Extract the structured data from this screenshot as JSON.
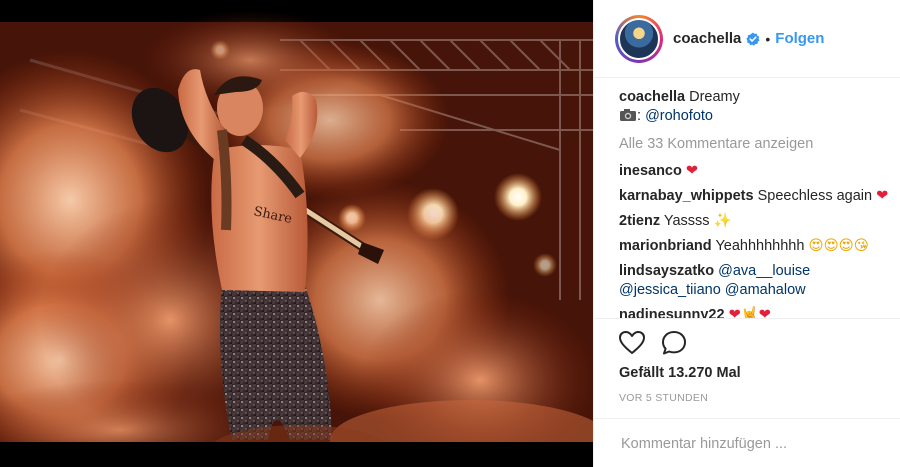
{
  "post": {
    "username": "coachella",
    "verified_icon": "verified-badge-icon",
    "separator": "•",
    "follow_label": "Folgen",
    "accent_color": "#3897f0"
  },
  "caption": {
    "username": "coachella",
    "text": "Dreamy",
    "camera_icon": "camera-icon",
    "credit_prefix": ":",
    "credit_mention": "@rohofoto"
  },
  "view_all_comments": "Alle 33 Kommentare anzeigen",
  "comments": [
    {
      "user": "inesanco",
      "text": "",
      "emoji": "❤"
    },
    {
      "user": "karnabay_whippets",
      "text": "Speechless again",
      "emoji": "❤"
    },
    {
      "user": "2tienz",
      "text": "Yassss",
      "emoji": "✨"
    },
    {
      "user": "marionbriand",
      "text": "Yeahhhhhhhh",
      "emoji": "😍😍😍😘"
    },
    {
      "user": "lindsayszatko",
      "mentions_line1": "@ava__louise",
      "mentions_line2": "@jessica_tiiano @amahalow"
    },
    {
      "user": "nadinesunny22",
      "text": "",
      "emoji": "❤🤘❤"
    }
  ],
  "actions": {
    "like_icon": "heart-outline-icon",
    "comment_icon": "comment-bubble-icon",
    "likes_text": "Gefällt 13.270 Mal",
    "timestamp": "VOR 5 STUNDEN"
  },
  "add_comment": {
    "placeholder": "Kommentar hinzufügen ..."
  }
}
